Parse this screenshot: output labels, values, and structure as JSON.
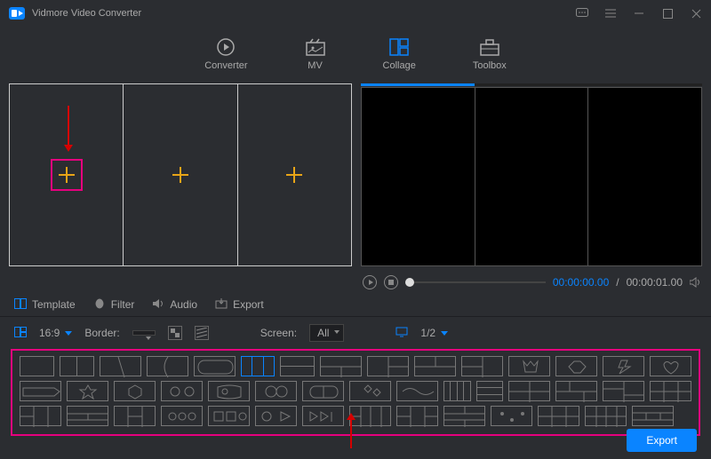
{
  "app": {
    "title": "Vidmore Video Converter"
  },
  "nav": {
    "converter": "Converter",
    "mv": "MV",
    "collage": "Collage",
    "toolbox": "Toolbox"
  },
  "player": {
    "current": "00:00:00.00",
    "total": "00:00:01.00"
  },
  "sections": {
    "template": "Template",
    "filter": "Filter",
    "audio": "Audio",
    "export": "Export"
  },
  "toolbar": {
    "ratio": "16:9",
    "border_label": "Border:",
    "screen_label": "Screen:",
    "screen_value": "All",
    "page": "1/2"
  },
  "footer": {
    "export": "Export"
  }
}
